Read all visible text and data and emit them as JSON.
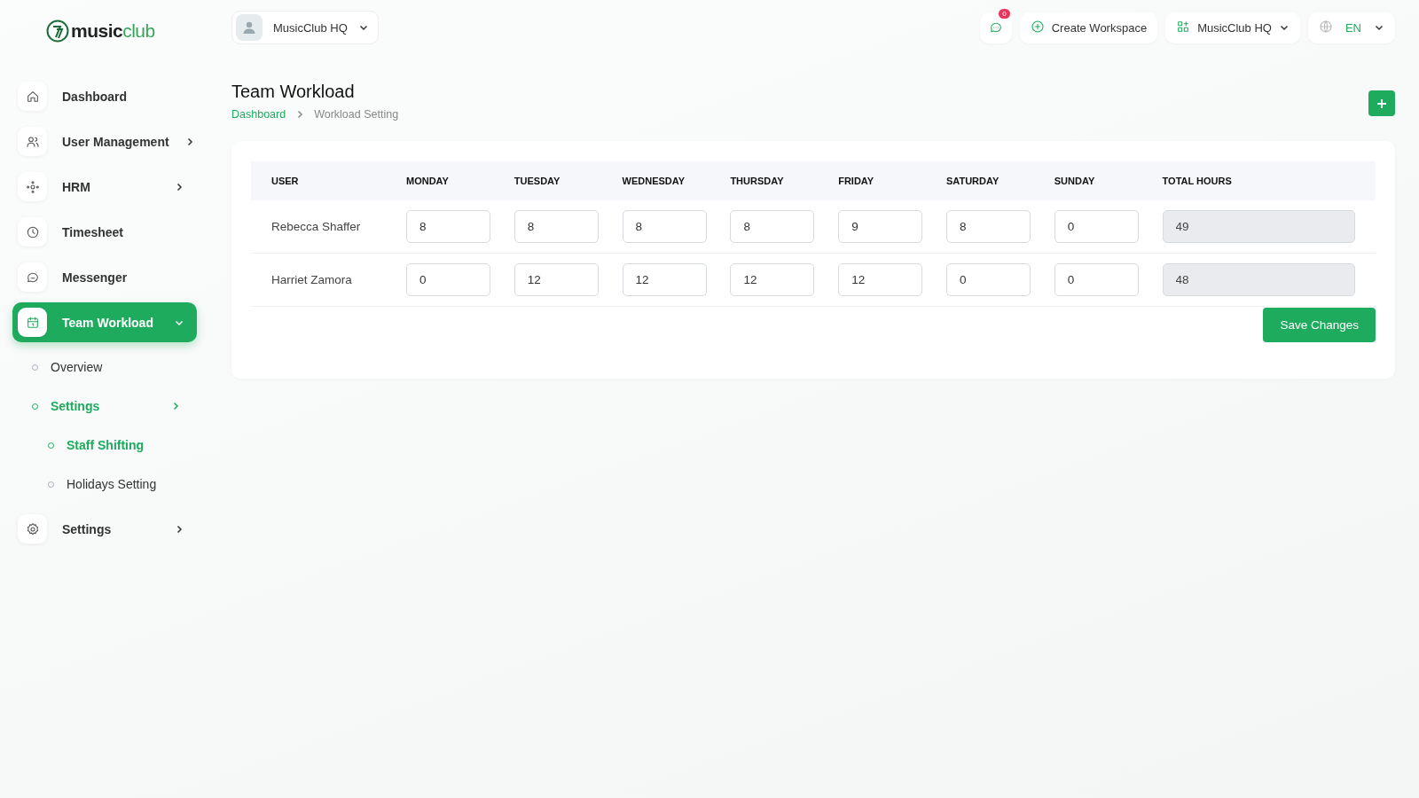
{
  "logo": {
    "strong": "music",
    "light": "club"
  },
  "workspace_switcher": {
    "label": "MusicClub HQ"
  },
  "topbar": {
    "notification_count": "0",
    "create_button": "Create Workspace",
    "workspace": "MusicClub HQ",
    "language": "EN"
  },
  "sidebar": {
    "items": [
      {
        "label": "Dashboard",
        "selected": false
      },
      {
        "label": "User Management",
        "selected": false,
        "expanded": false
      },
      {
        "label": "HRM",
        "selected": false,
        "expanded": false
      },
      {
        "label": "Timesheet",
        "selected": false
      },
      {
        "label": "Messenger",
        "selected": false
      },
      {
        "label": "Team Workload",
        "selected": true,
        "expanded": true,
        "children": [
          {
            "label": "Overview",
            "selected": false
          },
          {
            "label": "Settings",
            "selected": true,
            "expanded": true,
            "children": [
              {
                "label": "Staff Shifting",
                "selected": true
              },
              {
                "label": "Holidays Setting",
                "selected": false
              }
            ]
          }
        ]
      },
      {
        "label": "Settings",
        "selected": false,
        "expanded": false
      }
    ]
  },
  "page": {
    "title": "Team Workload",
    "breadcrumb": [
      {
        "label": "Dashboard",
        "link": true
      },
      {
        "label": "Workload Setting",
        "link": false
      }
    ]
  },
  "table": {
    "columns": [
      "USER",
      "MONDAY",
      "TUESDAY",
      "WEDNESDAY",
      "THURSDAY",
      "FRIDAY",
      "SATURDAY",
      "SUNDAY",
      "TOTAL HOURS"
    ],
    "rows": [
      {
        "user": "Rebecca Shaffer",
        "hours": [
          "8",
          "8",
          "8",
          "8",
          "9",
          "8",
          "0"
        ],
        "total": "49"
      },
      {
        "user": "Harriet Zamora",
        "hours": [
          "0",
          "12",
          "12",
          "12",
          "12",
          "0",
          "0"
        ],
        "total": "48"
      }
    ]
  },
  "save_button": "Save Changes"
}
